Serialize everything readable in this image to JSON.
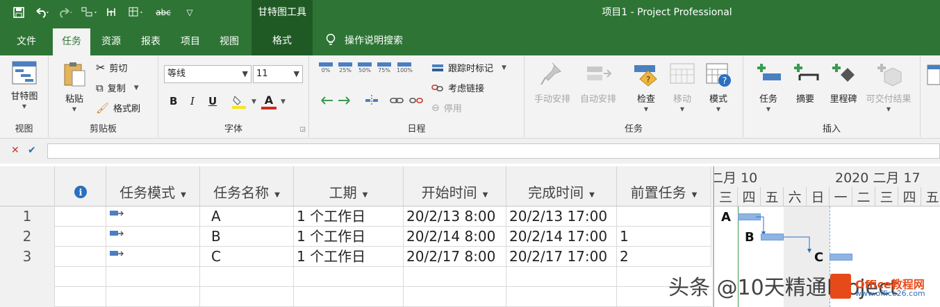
{
  "window": {
    "app_title": "项目1  -  Project Professional",
    "context_tools": "甘特图工具"
  },
  "tabs": {
    "file": "文件",
    "task": "任务",
    "resource": "资源",
    "report": "报表",
    "project": "项目",
    "view": "视图",
    "format": "格式",
    "tell_me": "操作说明搜索"
  },
  "ribbon": {
    "view_group": {
      "label": "视图",
      "gantt_chart": "甘特图"
    },
    "clipboard_group": {
      "label": "剪贴板",
      "paste": "粘贴",
      "cut": "剪切",
      "copy": "复制",
      "format_painter": "格式刷"
    },
    "font_group": {
      "label": "字体",
      "font_name": "等线",
      "font_size": "11",
      "bold": "B",
      "italic": "I",
      "underline": "U",
      "font_color": "A"
    },
    "schedule_group": {
      "label": "日程",
      "pct": [
        "0%",
        "25%",
        "50%",
        "75%",
        "100%"
      ],
      "mark_on_track": "跟踪时标记",
      "respect_links": "考虑链接",
      "inactivate": "停用"
    },
    "tasks_group": {
      "label": "任务",
      "manual": "手动安排",
      "auto": "自动安排",
      "inspect": "检查",
      "move": "移动",
      "mode": "模式"
    },
    "insert_group": {
      "label": "插入",
      "task": "任务",
      "summary": "摘要",
      "milestone": "里程碑",
      "deliverable": "可交付结果"
    }
  },
  "grid": {
    "headers": {
      "info": "i",
      "mode": "任务模式",
      "name": "任务名称",
      "duration": "工期",
      "start": "开始时间",
      "finish": "完成时间",
      "pred": "前置任务"
    },
    "rows": [
      {
        "num": "1",
        "name": "A",
        "duration": "1 个工作日",
        "start": "20/2/13 8:00",
        "finish": "20/2/13 17:00",
        "pred": ""
      },
      {
        "num": "2",
        "name": "B",
        "duration": "1 个工作日",
        "start": "20/2/14 8:00",
        "finish": "20/2/14 17:00",
        "pred": "1"
      },
      {
        "num": "3",
        "name": "C",
        "duration": "1 个工作日",
        "start": "20/2/17 8:00",
        "finish": "20/2/17 17:00",
        "pred": "2"
      }
    ]
  },
  "gantt": {
    "week1": "二月 10",
    "week2": "2020 二月 17",
    "days": [
      "三",
      "四",
      "五",
      "六",
      "日",
      "一",
      "二",
      "三",
      "四",
      "五"
    ],
    "bar_labels": [
      "A",
      "B",
      "C"
    ]
  },
  "watermark": {
    "text": "头条 @10天精通Project",
    "site_name": "Office教程网",
    "site_url": "www.office26.com"
  },
  "colors": {
    "title_green": "#2e7535",
    "bar_blue": "#8db4e2"
  }
}
